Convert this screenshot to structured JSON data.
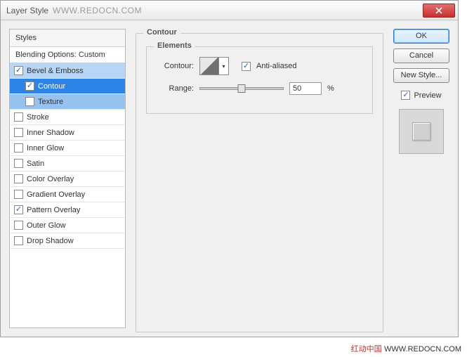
{
  "dialog": {
    "title": "Layer Style",
    "watermark": "WWW.REDOCN.COM",
    "close_icon": "close"
  },
  "styles": {
    "header": "Styles",
    "blending": "Blending Options: Custom",
    "effects": [
      {
        "label": "Bevel & Emboss",
        "checked": true,
        "sub": false,
        "hl": "bevel"
      },
      {
        "label": "Contour",
        "checked": true,
        "sub": true,
        "hl": "contour-sel"
      },
      {
        "label": "Texture",
        "checked": false,
        "sub": true,
        "hl": "texture-sel"
      },
      {
        "label": "Stroke",
        "checked": false,
        "sub": false,
        "hl": ""
      },
      {
        "label": "Inner Shadow",
        "checked": false,
        "sub": false,
        "hl": ""
      },
      {
        "label": "Inner Glow",
        "checked": false,
        "sub": false,
        "hl": ""
      },
      {
        "label": "Satin",
        "checked": false,
        "sub": false,
        "hl": ""
      },
      {
        "label": "Color Overlay",
        "checked": false,
        "sub": false,
        "hl": ""
      },
      {
        "label": "Gradient Overlay",
        "checked": false,
        "sub": false,
        "hl": ""
      },
      {
        "label": "Pattern Overlay",
        "checked": true,
        "sub": false,
        "hl": ""
      },
      {
        "label": "Outer Glow",
        "checked": false,
        "sub": false,
        "hl": ""
      },
      {
        "label": "Drop Shadow",
        "checked": false,
        "sub": false,
        "hl": ""
      }
    ]
  },
  "main": {
    "group_title": "Contour",
    "elements_title": "Elements",
    "contour_label": "Contour:",
    "anti_aliased_label": "Anti-aliased",
    "anti_aliased_checked": true,
    "range_label": "Range:",
    "range_value": "50",
    "range_unit": "%"
  },
  "buttons": {
    "ok": "OK",
    "cancel": "Cancel",
    "new_style": "New Style...",
    "preview_label": "Preview",
    "preview_checked": true
  },
  "footer": {
    "red": "红动中国",
    "url": "WWW.REDOCN.COM"
  }
}
